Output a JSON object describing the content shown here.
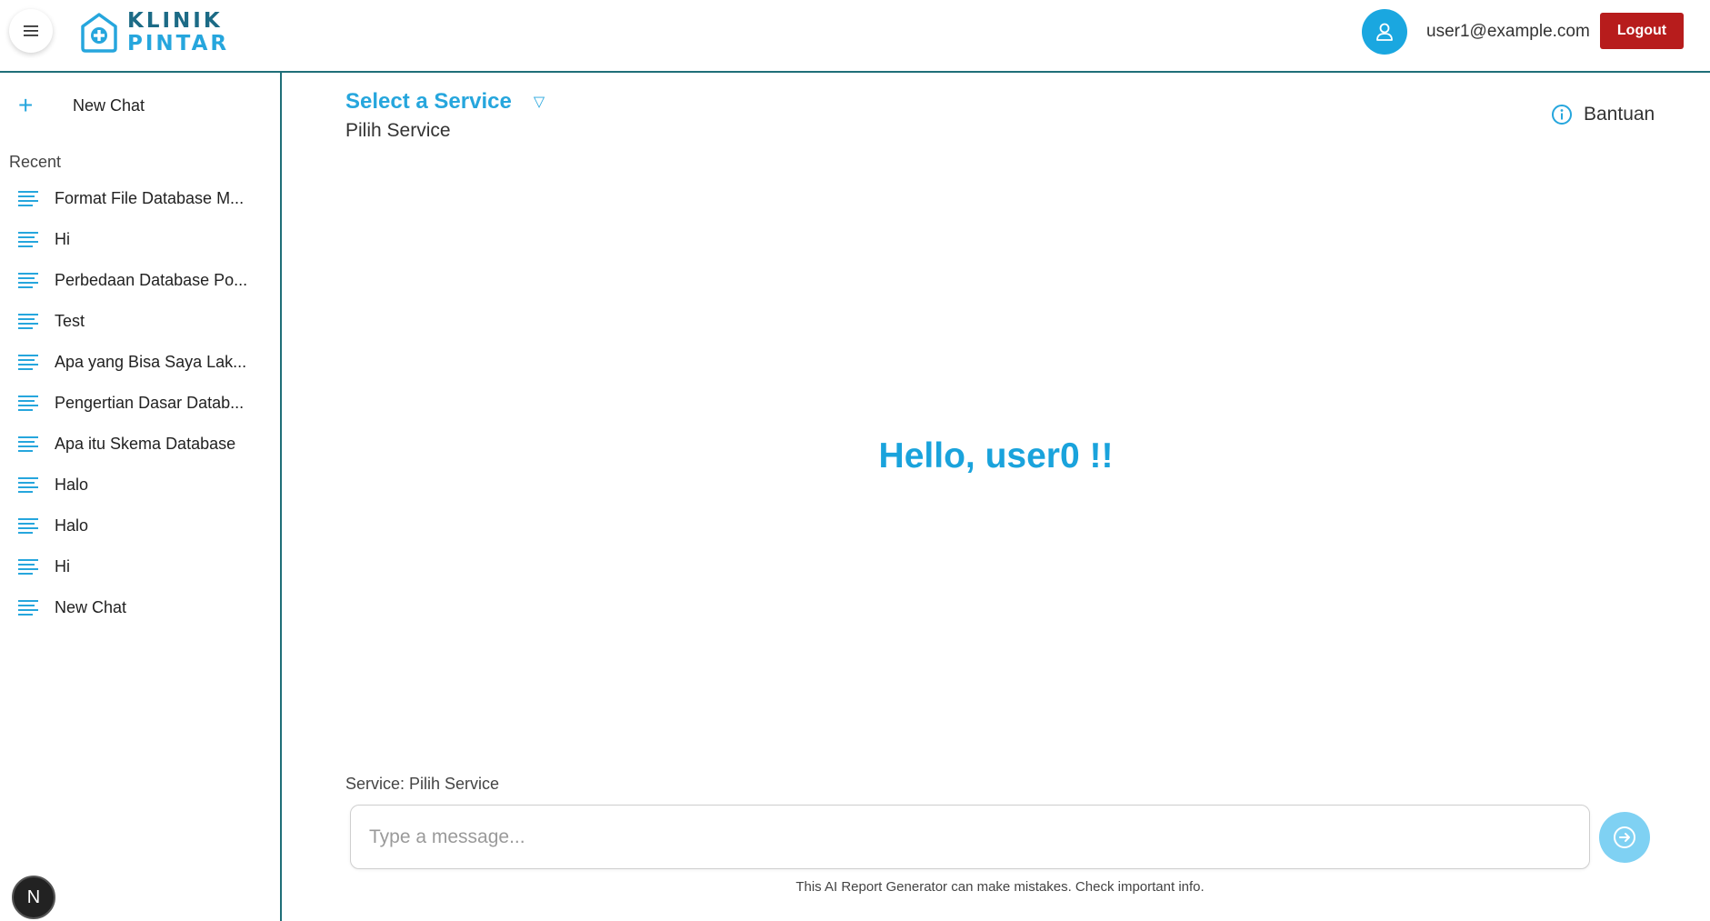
{
  "header": {
    "logo_line1": "KLINIK",
    "logo_line2": "PINTAR",
    "user_email": "user1@example.com",
    "logout_label": "Logout",
    "icons": {
      "menu": "hamburger-menu-icon",
      "avatar": "user-icon",
      "logo": "clinic-house-plus-icon"
    }
  },
  "sidebar": {
    "new_chat_label": "New Chat",
    "recent_title": "Recent",
    "items": [
      {
        "label": "Format File Database M..."
      },
      {
        "label": "Hi"
      },
      {
        "label": "Perbedaan Database Po..."
      },
      {
        "label": "Test"
      },
      {
        "label": "Apa yang Bisa Saya Lak..."
      },
      {
        "label": "Pengertian Dasar Datab..."
      },
      {
        "label": "Apa itu Skema Database"
      },
      {
        "label": "Halo"
      },
      {
        "label": "Halo"
      },
      {
        "label": "Hi"
      },
      {
        "label": "New Chat"
      }
    ],
    "badge_letter": "N"
  },
  "main": {
    "service_title": "Select a Service",
    "service_caret": "▽",
    "service_sub": "Pilih Service",
    "help_label": "Bantuan",
    "greeting": "Hello, user0 !!",
    "service_label": "Service: Pilih Service",
    "input_placeholder": "Type a message...",
    "disclaimer": "This AI Report Generator can make mistakes. Check important info."
  },
  "colors": {
    "accent": "#26a6dd",
    "logout": "#b71c1c",
    "border": "#1f6f78",
    "send": "#7fd1f3"
  }
}
